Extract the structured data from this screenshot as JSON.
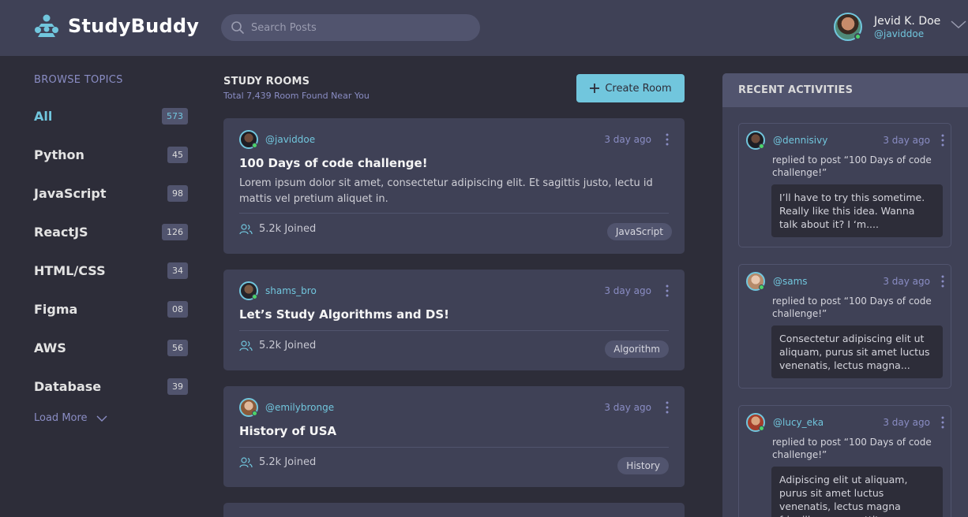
{
  "app": {
    "name": "StudyBuddy"
  },
  "search": {
    "placeholder": "Search Posts"
  },
  "user": {
    "name": "Jevid K. Doe",
    "handle": "@javiddoe"
  },
  "sidebar": {
    "title": "BROWSE TOPICS",
    "topics": [
      {
        "label": "All",
        "count": "573"
      },
      {
        "label": "Python",
        "count": "45"
      },
      {
        "label": "JavaScript",
        "count": "98"
      },
      {
        "label": "ReactJS",
        "count": "126"
      },
      {
        "label": "HTML/CSS",
        "count": "34"
      },
      {
        "label": "Figma",
        "count": "08"
      },
      {
        "label": "AWS",
        "count": "56"
      },
      {
        "label": "Database",
        "count": "39"
      }
    ],
    "load_more": "Load More"
  },
  "main": {
    "title": "STUDY ROOMS",
    "subtitle": "Total 7,439 Room Found Near You",
    "create_label": "Create Room",
    "rooms": [
      {
        "user": "@javiddoe",
        "time": "3 day ago",
        "title": "100 Days of code challenge!",
        "description": "Lorem ipsum dolor sit amet, consectetur adipiscing elit. Et sagittis justo, lectu id mattis vel pretium aliquet in.",
        "joined": "5.2k Joined",
        "tag": "JavaScript"
      },
      {
        "user": "shams_bro",
        "time": "3 day ago",
        "title": "Let’s Study Algorithms and DS!",
        "joined": "5.2k Joined",
        "tag": "Algorithm"
      },
      {
        "user": "@emilybronge",
        "time": "3 day ago",
        "title": "History of USA",
        "joined": "5.2k Joined",
        "tag": "History"
      }
    ]
  },
  "activity": {
    "title": "RECENT ACTIVITIES",
    "items": [
      {
        "user": "@dennisivy",
        "time": "3 day ago",
        "text": "replied to post  “100 Days of code challenge!”",
        "quote": "I’ll have to try this sometime. Really like this idea. Wanna talk about it? I ‘m...."
      },
      {
        "user": "@sams",
        "time": "3 day ago",
        "text": "replied to post  “100 Days of code challenge!”",
        "quote": "Consectetur adipiscing elit ut aliquam, purus sit amet luctus venenatis, lectus magna..."
      },
      {
        "user": "@lucy_eka",
        "time": "3 day ago",
        "text": "replied to post  “100 Days of code challenge!”",
        "quote": "Adipiscing elit ut aliquam, purus sit amet luctus venenatis, lectus magna fringilla urna, porttitor..."
      }
    ]
  },
  "colors": {
    "background": "#2d2d39",
    "panel": "#3f4156",
    "panel_light": "#51546e",
    "accent": "#71c6dd",
    "muted": "#8a8dc4",
    "online": "#4bd36a"
  }
}
